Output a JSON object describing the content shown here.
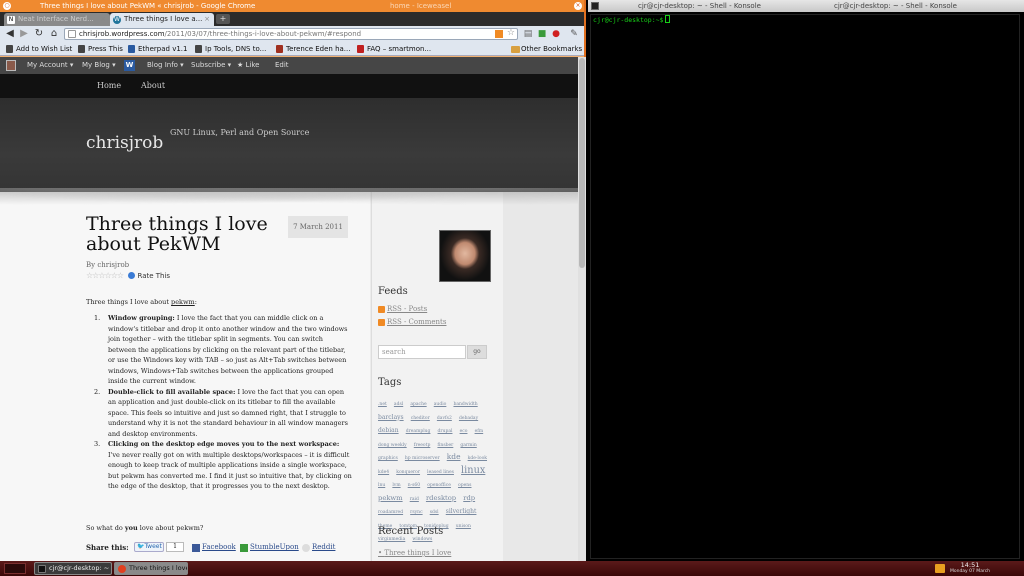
{
  "chrome": {
    "title": "Three things I love about PekWM « chrisjrob - Google Chrome",
    "title_inactive": "home - Iceweasel",
    "tabs": [
      {
        "label": "Neat Interface Nerd...",
        "icon": "N"
      },
      {
        "label": "Three things I love a...",
        "icon": "W"
      }
    ],
    "new_tab": "+",
    "url_host": "chrisjrob.wordpress.com",
    "url_path": "/2011/03/07/three-things-i-love-about-pekwm/#respond",
    "bookmarks": [
      "Add to Wish List",
      "Press This",
      "Etherpad v1.1",
      "Ip Tools, DNS to...",
      "Terence Eden ha...",
      "FAQ – smartmon..."
    ],
    "other_bookmarks": "Other Bookmarks"
  },
  "adminbar": {
    "items": [
      "My Account ▾",
      "My Blog ▾",
      "Blog Info ▾",
      "Subscribe ▾",
      "★ Like",
      "Edit"
    ],
    "logo": "W"
  },
  "site": {
    "nav": [
      "Home",
      "About"
    ],
    "title": "chrisjrob",
    "tagline": "GNU Linux, Perl and Open Source"
  },
  "post": {
    "title": "Three things I love about PekWM",
    "date": "7 March 2011",
    "byline": "By chrisjrob",
    "stars": "☆☆☆☆☆☆",
    "rate": "Rate This",
    "intro_pre": "Three things I love about ",
    "intro_link": "pekwm",
    "intro_post": ":",
    "items": [
      {
        "num": "1.",
        "head": "Window grouping:",
        "text": " I love the fact that you can middle click on a window's titlebar and drop it onto another window and the two windows join together – with the titlebar split in segments. You can switch between the applications by clicking on the relevant part of the titlebar, or use the Windows key with TAB – so just as Alt+Tab switches between windows, Windows+Tab switches between the applications grouped inside the current window."
      },
      {
        "num": "2.",
        "head": "Double-click to fill available space:",
        "text": " I love the fact that you can open an application and just double-click on its titlebar to fill the available space. This feels so intuitive and just so damned right, that I struggle to understand why it is not the standard behaviour in all window managers and desktop environments."
      },
      {
        "num": "3.",
        "head": "Clicking on the desktop edge moves you to the next workspace:",
        "text": " I've never really got on with multiple desktops/workspaces – it is difficult enough to keep track of multiple applications inside a single workspace, but pekwm has converted me. I find it just so intuitive that, by clicking on the edge of the desktop, that it progresses you to the next desktop."
      }
    ],
    "outro_pre": "So what do ",
    "outro_bold": "you",
    "outro_post": " love about pekwm?",
    "share_label": "Share this:",
    "tweet": "Tweet",
    "tweet_count": "1",
    "share_links": [
      "Facebook",
      "StumbleUpon",
      "Reddit"
    ]
  },
  "sidebar": {
    "feeds_head": "Feeds",
    "feeds": [
      "RSS - Posts",
      "RSS - Comments"
    ],
    "search_placeholder": "search",
    "search_button": "go",
    "tags_head": "Tags",
    "tags": [
      {
        "t": ".net",
        "s": 6
      },
      {
        "t": "adsl",
        "s": 6
      },
      {
        "t": "apache",
        "s": 6
      },
      {
        "t": "audio",
        "s": 6
      },
      {
        "t": "bandwidth",
        "s": 6
      },
      {
        "t": "barclays",
        "s": 8
      },
      {
        "t": "cheditor",
        "s": 6
      },
      {
        "t": "davfs2",
        "s": 6
      },
      {
        "t": "debaday",
        "s": 6
      },
      {
        "t": "debian",
        "s": 8
      },
      {
        "t": "dreamplug",
        "s": 6
      },
      {
        "t": "drupal",
        "s": 6
      },
      {
        "t": "eco",
        "s": 6
      },
      {
        "t": "efm",
        "s": 6
      },
      {
        "t": "dong weekly",
        "s": 6
      },
      {
        "t": "freeotp",
        "s": 6
      },
      {
        "t": "finsber",
        "s": 6
      },
      {
        "t": "garmin",
        "s": 6
      },
      {
        "t": "graphics",
        "s": 6
      },
      {
        "t": "hp microserver",
        "s": 6
      },
      {
        "t": "kde",
        "s": 10
      },
      {
        "t": "kde-look",
        "s": 6
      },
      {
        "t": "kde4",
        "s": 6
      },
      {
        "t": "konqueror",
        "s": 6
      },
      {
        "t": "leased lines",
        "s": 6
      },
      {
        "t": "linux",
        "s": 13
      },
      {
        "t": "lnu",
        "s": 6
      },
      {
        "t": "lvm",
        "s": 6
      },
      {
        "t": "n-s60",
        "s": 6
      },
      {
        "t": "openoffice",
        "s": 6
      },
      {
        "t": "opens",
        "s": 6
      },
      {
        "t": "pekwm",
        "s": 9
      },
      {
        "t": "raid",
        "s": 6
      },
      {
        "t": "rdesktop",
        "s": 9
      },
      {
        "t": "rdp",
        "s": 9
      },
      {
        "t": "roadamred",
        "s": 6
      },
      {
        "t": "rsync",
        "s": 6
      },
      {
        "t": "sdsl",
        "s": 6
      },
      {
        "t": "silverlight",
        "s": 8
      },
      {
        "t": "theme",
        "s": 6
      },
      {
        "t": "tomtom",
        "s": 6
      },
      {
        "t": "tonidoplug",
        "s": 6
      },
      {
        "t": "unison",
        "s": 6
      },
      {
        "t": "virginmedia",
        "s": 6
      },
      {
        "t": "windows",
        "s": 6
      }
    ],
    "recent_head": "Recent Posts",
    "recent": [
      "Three things I love"
    ]
  },
  "konsole": {
    "title_left": "cjr@cjr-desktop: ~ - Shell - Konsole",
    "title_right": "cjr@cjr-desktop: ~ - Shell - Konsole",
    "prompt": "cjr@cjr-desktop:~$"
  },
  "taskbar": {
    "tasks": [
      "cjr@cjr-desktop: ~ - ...",
      "Three things I love a..."
    ],
    "time": "14:51",
    "date": "Monday 07 March"
  },
  "colors": {
    "chrome_title": "#ef8a30",
    "terminal_text": "#18d018",
    "taskbar": "#4a1010"
  }
}
